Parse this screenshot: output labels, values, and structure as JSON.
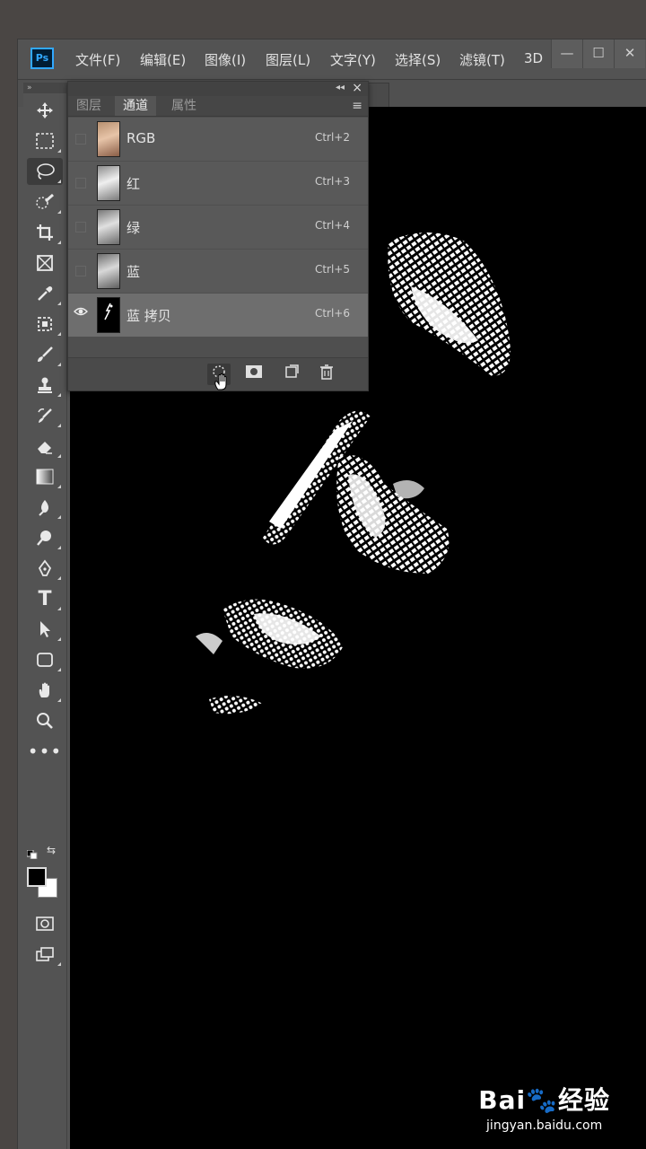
{
  "app": {
    "logo": "Ps",
    "menu": [
      "文件(F)",
      "编辑(E)",
      "图像(I)",
      "图层(L)",
      "文字(Y)",
      "选择(S)",
      "滤镜(T)",
      "3D"
    ],
    "window_buttons": [
      "—",
      "☐",
      "✕"
    ]
  },
  "panel": {
    "tabs": [
      "图层",
      "通道",
      "属性"
    ],
    "active_tab": "通道",
    "channels": [
      {
        "name": "RGB",
        "shortcut": "Ctrl+2",
        "visible": false,
        "thumb": "color-portrait"
      },
      {
        "name": "红",
        "shortcut": "Ctrl+3",
        "visible": false,
        "thumb": "gray-portrait"
      },
      {
        "name": "绿",
        "shortcut": "Ctrl+4",
        "visible": false,
        "thumb": "gray-portrait"
      },
      {
        "name": "蓝",
        "shortcut": "Ctrl+5",
        "visible": false,
        "thumb": "gray-portrait"
      },
      {
        "name": "蓝 拷贝",
        "shortcut": "Ctrl+6",
        "visible": true,
        "selected": true,
        "thumb": "mask"
      }
    ],
    "footer_icons": [
      "load-channel-as-selection-icon",
      "save-selection-as-channel-icon",
      "new-channel-icon",
      "delete-channel-icon"
    ]
  },
  "toolbar": {
    "tools": [
      "move-icon",
      "marquee-icon",
      "lasso-icon",
      "quick-select-icon",
      "crop-icon",
      "frame-icon",
      "eyedropper-icon",
      "healing-icon",
      "brush-icon",
      "stamp-icon",
      "history-brush-icon",
      "eraser-icon",
      "gradient-icon",
      "blur-icon",
      "dodge-icon",
      "pen-icon",
      "type-icon",
      "path-select-icon",
      "shape-icon",
      "hand-icon",
      "zoom-icon",
      "more-icon"
    ],
    "active_tool": "lasso-icon",
    "foreground": "#000000",
    "background": "#ffffff"
  },
  "watermark": {
    "main": "Bai🐾经验",
    "sub": "jingyan.baidu.com"
  }
}
